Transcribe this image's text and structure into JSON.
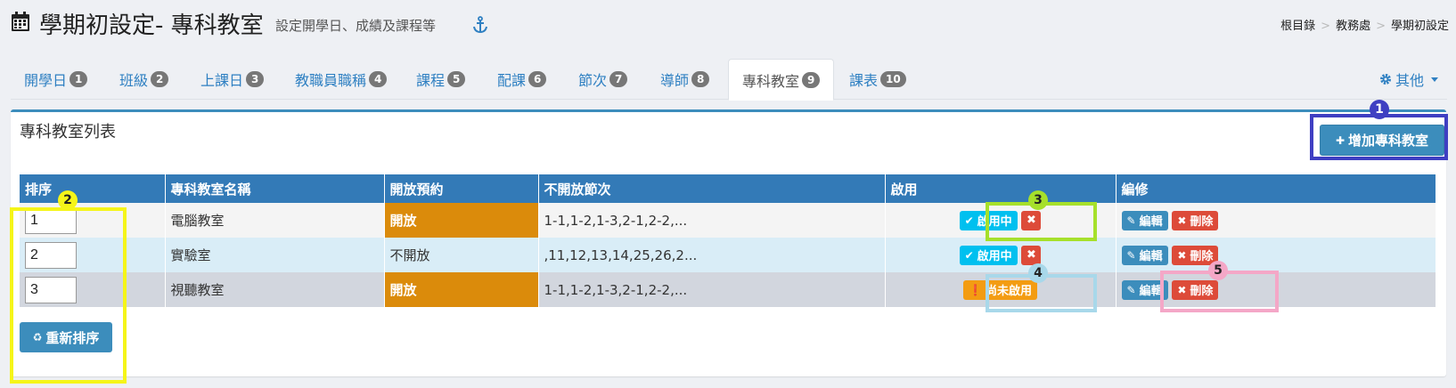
{
  "header": {
    "title": "學期初設定- 專科教室",
    "subtitle": "設定開學日、成績及課程等",
    "icons": {
      "title": "calendar-icon",
      "pin": "anchor-icon"
    }
  },
  "breadcrumb": [
    "根目錄",
    "教務處",
    "學期初設定"
  ],
  "tabs": [
    {
      "label": "開學日",
      "badge": "1"
    },
    {
      "label": "班級",
      "badge": "2"
    },
    {
      "label": "上課日",
      "badge": "3"
    },
    {
      "label": "教職員職稱",
      "badge": "4"
    },
    {
      "label": "課程",
      "badge": "5"
    },
    {
      "label": "配課",
      "badge": "6"
    },
    {
      "label": "節次",
      "badge": "7"
    },
    {
      "label": "導師",
      "badge": "8"
    },
    {
      "label": "專科教室",
      "badge": "9",
      "active": true
    },
    {
      "label": "課表",
      "badge": "10"
    }
  ],
  "other_menu": {
    "label": "其他",
    "icon": "gear-icon"
  },
  "panel": {
    "title": "專科教室列表",
    "add_button": "增加專科教室",
    "reorder_button": "重新排序"
  },
  "table": {
    "headers": [
      "排序",
      "專科教室名稱",
      "開放預約",
      "不開放節次",
      "啟用",
      "編修"
    ],
    "rows": [
      {
        "order": "1",
        "name": "電腦教室",
        "reserve": "開放",
        "closed_periods": "1-1,1-2,1-3,2-1,2-2,...",
        "status": "啟用中"
      },
      {
        "order": "2",
        "name": "實驗室",
        "reserve": "不開放",
        "closed_periods": ",11,12,13,14,25,26,2...",
        "status": "啟用中"
      },
      {
        "order": "3",
        "name": "視聽教室",
        "reserve": "開放",
        "closed_periods": "1-1,1-2,1-3,2-1,2-2,...",
        "status": "尚未啟用"
      }
    ],
    "edit_label": "編輯",
    "delete_label": "刪除"
  },
  "callouts": [
    "1",
    "2",
    "3",
    "4",
    "5"
  ],
  "colors": {
    "primary": "#3c8dbc",
    "table_header": "#337ab7",
    "open_cell": "#db8b0b",
    "info": "#00c0ef",
    "danger": "#dd4b39",
    "warning": "#f39c12",
    "callout_1": "#3f3fc2",
    "callout_2": "#f5f519",
    "callout_3": "#a6e02b",
    "callout_4": "#a8d8ea",
    "callout_5": "#f4a7c7"
  }
}
